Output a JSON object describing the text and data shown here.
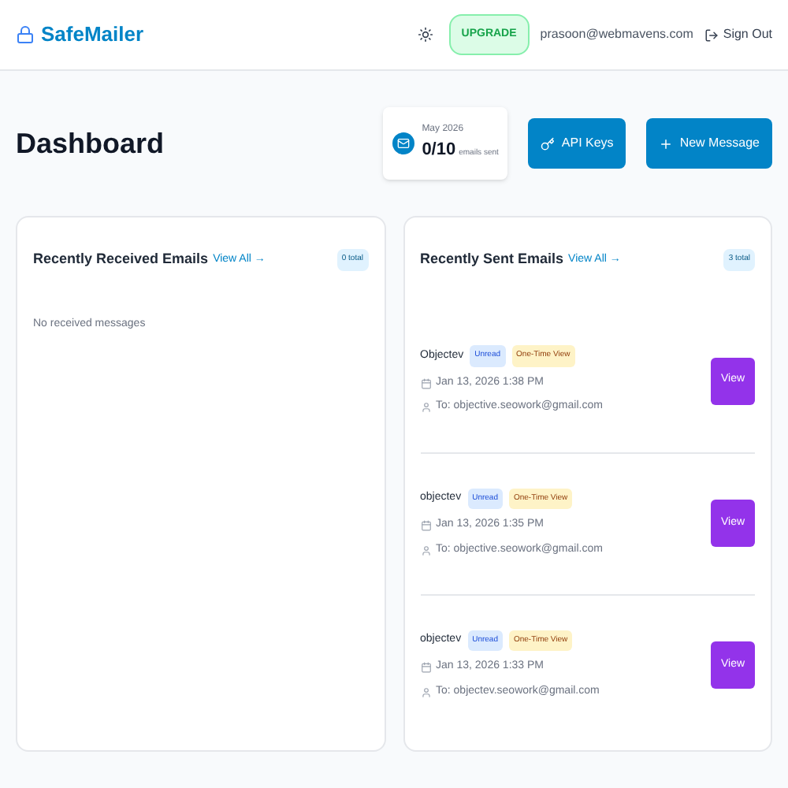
{
  "header": {
    "brand": "SafeMailer",
    "upgrade": "UPGRADE",
    "email": "prasoon@webmavens.com",
    "sign_out": "Sign Out"
  },
  "page": {
    "title": "Dashboard",
    "usage": {
      "period": "May 2026",
      "count": "0/10",
      "unit": "emails sent"
    },
    "buttons": [
      {
        "kind": "key",
        "label": "API Keys"
      },
      {
        "kind": "plus",
        "label": "New Message"
      }
    ]
  },
  "received": {
    "title": "Recently Received Emails",
    "view_all": "View All →",
    "total": "0 total",
    "empty": "No received messages"
  },
  "sent": {
    "title": "Recently Sent Emails",
    "view_all": "View All →",
    "total": "3 total",
    "emails": [
      {
        "subject": "Objectev",
        "badges": [
          {
            "kind": "status",
            "label": "Unread"
          },
          {
            "kind": "mode",
            "label": "One-Time View"
          }
        ],
        "date": "Jan 13, 2026 1:38 PM",
        "to": "To: objective.seowork@gmail.com",
        "action": "View"
      },
      {
        "subject": "objectev",
        "badges": [
          {
            "kind": "status",
            "label": "Unread"
          },
          {
            "kind": "mode",
            "label": "One-Time View"
          }
        ],
        "date": "Jan 13, 2026 1:35 PM",
        "to": "To: objective.seowork@gmail.com",
        "action": "View"
      },
      {
        "subject": "objectev",
        "badges": [
          {
            "kind": "status",
            "label": "Unread"
          },
          {
            "kind": "mode",
            "label": "One-Time View"
          }
        ],
        "date": "Jan 13, 2026 1:33 PM",
        "to": "To: objectev.seowork@gmail.com",
        "action": "View"
      }
    ]
  }
}
